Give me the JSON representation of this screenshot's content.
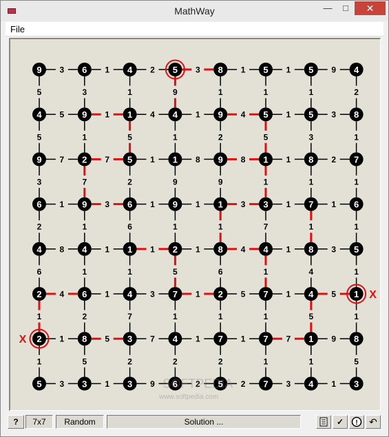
{
  "window": {
    "title": "MathWay",
    "minimize": "—",
    "maximize": "□",
    "close": "✕"
  },
  "menu": {
    "file": "File"
  },
  "puzzle": {
    "nodes": [
      [
        9,
        6,
        4,
        5,
        8,
        5,
        5,
        4
      ],
      [
        4,
        9,
        1,
        4,
        9,
        5,
        5,
        8
      ],
      [
        9,
        2,
        5,
        1,
        9,
        1,
        8,
        7
      ],
      [
        6,
        9,
        6,
        9,
        1,
        3,
        7,
        6
      ],
      [
        4,
        4,
        1,
        2,
        8,
        4,
        8,
        5
      ],
      [
        2,
        6,
        4,
        7,
        2,
        7,
        4,
        1
      ],
      [
        2,
        8,
        3,
        4,
        7,
        7,
        1,
        8
      ],
      [
        5,
        3,
        3,
        6,
        5,
        7,
        4,
        3
      ]
    ],
    "h_edges": [
      [
        3,
        1,
        2,
        3,
        1,
        1,
        9
      ],
      [
        5,
        1,
        4,
        1,
        4,
        1,
        3
      ],
      [
        7,
        7,
        1,
        8,
        8,
        1,
        2
      ],
      [
        1,
        3,
        1,
        1,
        3,
        1,
        1
      ],
      [
        8,
        1,
        1,
        1,
        4,
        1,
        3
      ],
      [
        4,
        1,
        3,
        1,
        5,
        1,
        5
      ],
      [
        1,
        5,
        7,
        1,
        1,
        7,
        9
      ],
      [
        3,
        1,
        9,
        2,
        2,
        3,
        1
      ]
    ],
    "v_edges": [
      [
        5,
        3,
        1,
        9,
        1,
        1,
        1,
        2
      ],
      [
        5,
        1,
        5,
        1,
        2,
        5,
        3,
        1
      ],
      [
        3,
        7,
        2,
        9,
        9,
        1,
        1,
        1
      ],
      [
        2,
        1,
        6,
        1,
        1,
        7,
        1,
        1
      ],
      [
        6,
        1,
        1,
        5,
        6,
        1,
        4,
        1
      ],
      [
        1,
        2,
        7,
        1,
        1,
        1,
        5,
        1
      ],
      [
        1,
        5,
        2,
        2,
        2,
        1,
        1,
        5
      ]
    ],
    "path_h": [
      [
        0,
        0,
        0,
        1,
        0,
        0,
        0
      ],
      [
        0,
        1,
        0,
        0,
        1,
        0,
        0
      ],
      [
        0,
        1,
        0,
        0,
        1,
        0,
        0
      ],
      [
        0,
        1,
        0,
        0,
        1,
        0,
        0
      ],
      [
        0,
        0,
        1,
        0,
        1,
        0,
        0
      ],
      [
        1,
        0,
        0,
        1,
        0,
        0,
        1
      ],
      [
        0,
        1,
        0,
        0,
        0,
        1,
        0
      ],
      [
        0,
        0,
        0,
        0,
        0,
        0,
        0
      ]
    ],
    "path_v": [
      [
        0,
        0,
        0,
        1,
        0,
        0,
        0,
        0
      ],
      [
        0,
        0,
        1,
        0,
        0,
        1,
        0,
        0
      ],
      [
        0,
        1,
        0,
        0,
        0,
        1,
        0,
        0
      ],
      [
        0,
        0,
        0,
        0,
        1,
        0,
        1,
        0
      ],
      [
        0,
        0,
        0,
        1,
        0,
        1,
        0,
        0
      ],
      [
        1,
        0,
        0,
        0,
        0,
        0,
        1,
        0
      ],
      [
        0,
        0,
        0,
        0,
        0,
        0,
        0,
        0
      ]
    ],
    "circled": [
      [
        0,
        3
      ],
      [
        5,
        7
      ],
      [
        6,
        0
      ]
    ],
    "markers": [
      {
        "label": "X",
        "row": 5,
        "col": 7,
        "side": "right"
      },
      {
        "label": "X",
        "row": 6,
        "col": 0,
        "side": "left"
      }
    ],
    "colors": {
      "node": "#000000",
      "path": "#e01010",
      "marker": "#e01010",
      "grid": "#000000"
    }
  },
  "watermark": {
    "main": "SOFTPEDIA",
    "sub": "www.softpedia.com"
  },
  "statusbar": {
    "help": "?",
    "size": "7x7",
    "random": "Random",
    "status": "Solution ...",
    "notes_icon": "notepad-icon",
    "check": "✓",
    "hint": "!",
    "undo": "↶"
  }
}
